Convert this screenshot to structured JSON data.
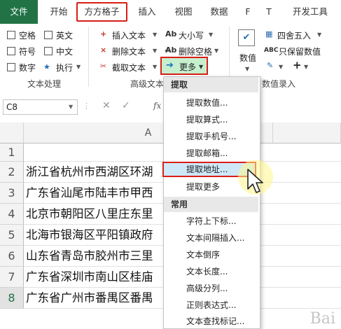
{
  "tabs": [
    {
      "label": "文件"
    },
    {
      "label": "开始"
    },
    {
      "label": "方方格子"
    },
    {
      "label": "插入"
    },
    {
      "label": "视图"
    },
    {
      "label": "数据"
    },
    {
      "label": "F"
    },
    {
      "label": "T"
    },
    {
      "label": "开发工具"
    }
  ],
  "ribbon": {
    "text_group": {
      "checkboxes": [
        "空格",
        "英文",
        "符号",
        "中文",
        "数字"
      ],
      "execute": "执行",
      "label": "文本处理"
    },
    "advanced_group": {
      "insert_text": "插入文本",
      "delete_text": "删除文本",
      "extract_text": "截取文本",
      "case": "大小写",
      "delete_space": "删除空格",
      "more": "更多",
      "label": "高级文本"
    },
    "number_group": {
      "value": "数值",
      "round": "四舍五入",
      "keep_value": "只保留数值",
      "label": "数值录入"
    }
  },
  "formula_bar": {
    "name_box": "C8",
    "fx": "fx"
  },
  "grid": {
    "col_a": "A",
    "rows": [
      "1",
      "2",
      "3",
      "4",
      "5",
      "6",
      "7",
      "8"
    ],
    "cells": [
      "",
      "浙江省杭州市西湖区环湖",
      "广东省汕尾市陆丰市甲西",
      "北京市朝阳区八里庄东里",
      "北海市银海区平阳镇政府",
      "山东省青岛市胶州市三里",
      "广东省深圳市南山区桂庙",
      "广东省广州市番禺区番禺"
    ]
  },
  "menu": {
    "header_extract": "提取",
    "extract_items": [
      "提取数值...",
      "提取算式...",
      "提取手机号...",
      "提取邮箱...",
      "提取地址...",
      "提取更多"
    ],
    "header_common": "常用",
    "common_items": [
      "字符上下标...",
      "文本间隔插入...",
      "文本倒序",
      "文本长度...",
      "高级分列...",
      "正则表达式...",
      "文本查找标记..."
    ]
  },
  "watermark": "Bai",
  "colors": {
    "excel_green": "#217346",
    "highlight_red": "#d91e18",
    "hover_blue": "#cfe8f8"
  }
}
